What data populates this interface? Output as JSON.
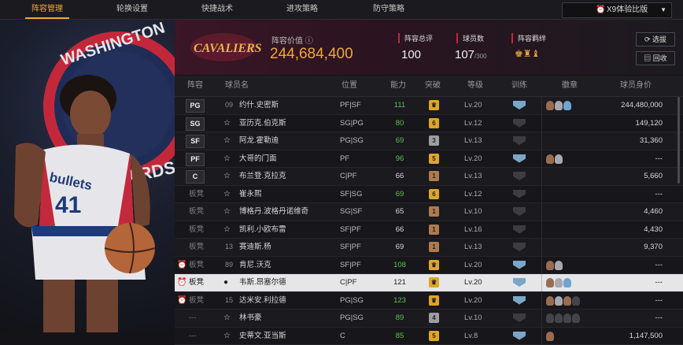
{
  "tabs": [
    "阵容管理",
    "轮换设置",
    "快捷战术",
    "进攻策略",
    "防守策略"
  ],
  "version_select": {
    "label": "X9体验比版",
    "icon": "alarm-clock-icon"
  },
  "team": {
    "logo_text": "CAVALIERS",
    "lineup_value_label": "阵容价值",
    "lineup_value": "244,684,400",
    "stats": [
      {
        "label": "阵容总评",
        "value": "100",
        "sub": ""
      },
      {
        "label": "球员数",
        "value": "107",
        "sub": "/300"
      },
      {
        "label": "阵容羁绊",
        "value": "",
        "sub": ""
      }
    ]
  },
  "buttons": {
    "select": "选拔",
    "recycle": "回收"
  },
  "columns": [
    "阵容",
    "球员名",
    "位置",
    "能力",
    "突破",
    "等级",
    "训练",
    "徽章",
    "球员身价"
  ],
  "rows": [
    {
      "slot": "PG",
      "num": "09",
      "name": "约什.史密斯",
      "pos": "PF|SF",
      "ovr": "111",
      "ovr_green": true,
      "brk": "♛",
      "brk_color": "gold",
      "lvl": "Lv.20",
      "train": true,
      "badges": [
        "bronze",
        "silver",
        "blue"
      ],
      "price": "244,480,000",
      "alarm": false
    },
    {
      "slot": "SG",
      "num": "",
      "name": "亚历克.伯克斯",
      "pos": "SG|PG",
      "ovr": "80",
      "ovr_green": true,
      "brk": "6",
      "brk_color": "gold",
      "lvl": "Lv.12",
      "train": false,
      "badges": [],
      "price": "149,120",
      "alarm": false
    },
    {
      "slot": "SF",
      "num": "",
      "name": "阿龙.霍勒迪",
      "pos": "PG|SG",
      "ovr": "69",
      "ovr_green": true,
      "brk": "3",
      "brk_color": "grey",
      "lvl": "Lv.13",
      "train": false,
      "badges": [],
      "price": "31,360",
      "alarm": false
    },
    {
      "slot": "PF",
      "num": "",
      "name": "大哥的门面",
      "pos": "PF",
      "ovr": "96",
      "ovr_green": true,
      "brk": "5",
      "brk_color": "gold",
      "lvl": "Lv.20",
      "train": true,
      "badges": [
        "bronze",
        "silver"
      ],
      "price": "---",
      "alarm": false
    },
    {
      "slot": "C",
      "num": "",
      "name": "布兰登.克拉克",
      "pos": "C|PF",
      "ovr": "66",
      "ovr_green": false,
      "brk": "1",
      "brk_color": "bronze",
      "lvl": "Lv.13",
      "train": false,
      "badges": [],
      "price": "5,660",
      "alarm": false
    },
    {
      "slot": "板凳",
      "num": "",
      "name": "崔永熙",
      "pos": "SF|SG",
      "ovr": "69",
      "ovr_green": true,
      "brk": "6",
      "brk_color": "gold",
      "lvl": "Lv.12",
      "train": false,
      "badges": [],
      "price": "---",
      "alarm": false
    },
    {
      "slot": "板凳",
      "num": "",
      "name": "博格丹.波格丹诺维奇",
      "pos": "SG|SF",
      "ovr": "65",
      "ovr_green": false,
      "brk": "1",
      "brk_color": "bronze",
      "lvl": "Lv.10",
      "train": false,
      "badges": [],
      "price": "4,460",
      "alarm": false
    },
    {
      "slot": "板凳",
      "num": "",
      "name": "凯利.小欧布雷",
      "pos": "SF|PF",
      "ovr": "66",
      "ovr_green": false,
      "brk": "1",
      "brk_color": "bronze",
      "lvl": "Lv.16",
      "train": false,
      "badges": [],
      "price": "4,430",
      "alarm": false
    },
    {
      "slot": "板凳",
      "num": "13",
      "name": "赛迪斯.杨",
      "pos": "SF|PF",
      "ovr": "69",
      "ovr_green": false,
      "brk": "1",
      "brk_color": "bronze",
      "lvl": "Lv.13",
      "train": false,
      "badges": [],
      "price": "9,370",
      "alarm": false
    },
    {
      "slot": "板凳",
      "num": "89",
      "name": "肯尼.沃克",
      "pos": "SF|PF",
      "ovr": "108",
      "ovr_green": true,
      "brk": "♛",
      "brk_color": "gold",
      "lvl": "Lv.20",
      "train": true,
      "badges": [
        "bronze",
        "silver"
      ],
      "price": "---",
      "alarm": true
    },
    {
      "slot": "板凳",
      "num": "",
      "name": "韦斯.昂塞尔德",
      "pos": "C|PF",
      "ovr": "121",
      "ovr_green": false,
      "brk": "♛",
      "brk_color": "gold",
      "lvl": "Lv.20",
      "train": true,
      "badges": [
        "bronze",
        "silver",
        "blue"
      ],
      "price": "---",
      "alarm": true,
      "selected": true
    },
    {
      "slot": "板凳",
      "num": "15",
      "name": "达米安.利拉德",
      "pos": "PG|SG",
      "ovr": "123",
      "ovr_green": true,
      "brk": "♛",
      "brk_color": "gold",
      "lvl": "Lv.20",
      "train": true,
      "badges": [
        "bronze",
        "silver",
        "bronze",
        "dark"
      ],
      "price": "---",
      "alarm": true
    },
    {
      "slot": "---",
      "num": "",
      "name": "林书豪",
      "pos": "PG|SG",
      "ovr": "89",
      "ovr_green": true,
      "brk": "4",
      "brk_color": "grey",
      "lvl": "Lv.10",
      "train": false,
      "badges": [
        "dark",
        "dark",
        "dark",
        "dark"
      ],
      "price": "---",
      "alarm": false
    },
    {
      "slot": "---",
      "num": "",
      "name": "史蒂文.亚当斯",
      "pos": "C",
      "ovr": "85",
      "ovr_green": true,
      "brk": "5",
      "brk_color": "gold",
      "lvl": "Lv.8",
      "train": true,
      "badges": [
        "bronze"
      ],
      "price": "1,147,500",
      "alarm": false
    }
  ]
}
